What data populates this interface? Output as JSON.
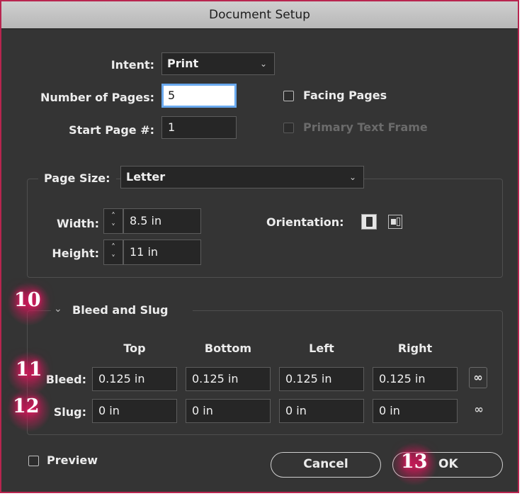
{
  "dialog": {
    "title": "Document Setup"
  },
  "intent": {
    "label": "Intent:",
    "value": "Print"
  },
  "pages": {
    "label": "Number of Pages:",
    "value": "5"
  },
  "start_page": {
    "label": "Start Page #:",
    "value": "1"
  },
  "facing_pages": {
    "label": "Facing Pages",
    "checked": false
  },
  "primary_text_frame": {
    "label": "Primary Text Frame",
    "checked": false,
    "enabled": false
  },
  "page_size": {
    "label": "Page Size:",
    "value": "Letter",
    "width_label": "Width:",
    "width": "8.5 in",
    "height_label": "Height:",
    "height": "11 in",
    "orientation_label": "Orientation:"
  },
  "bleed_slug": {
    "title": "Bleed and Slug",
    "columns": [
      "Top",
      "Bottom",
      "Left",
      "Right"
    ],
    "bleed_label": "Bleed:",
    "bleed": [
      "0.125 in",
      "0.125 in",
      "0.125 in",
      "0.125 in"
    ],
    "slug_label": "Slug:",
    "slug": [
      "0 in",
      "0 in",
      "0 in",
      "0 in"
    ]
  },
  "preview": {
    "label": "Preview",
    "checked": false
  },
  "buttons": {
    "cancel": "Cancel",
    "ok": "OK"
  },
  "markers": {
    "m10": "10",
    "m11": "11",
    "m12": "12",
    "m13": "13"
  },
  "colors": {
    "border": "#b8254f",
    "background": "#343434",
    "marker_glow": "#d4145a",
    "focus": "#6aa9ee"
  }
}
